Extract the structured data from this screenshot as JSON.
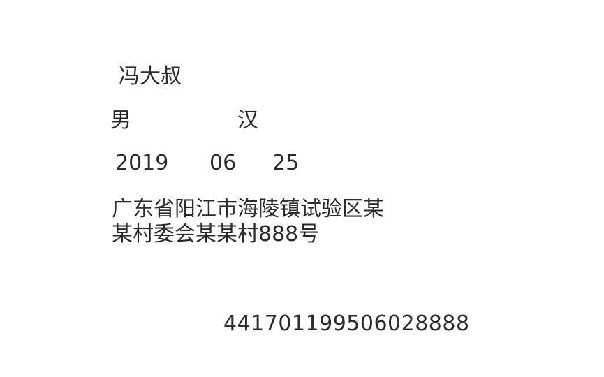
{
  "card": {
    "name": "冯大叔",
    "gender": "男",
    "ethnicity": "汉",
    "birth": {
      "year": "2019",
      "month": "06",
      "day": "25"
    },
    "address": {
      "line1": "广东省阳江市海陵镇试验区某",
      "line2": "某村委会某某村888号"
    },
    "id_number": "441701199506028888"
  }
}
